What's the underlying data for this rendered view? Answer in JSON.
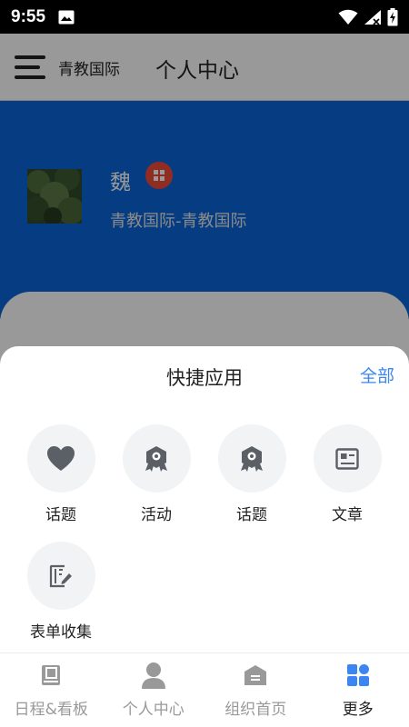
{
  "status_bar": {
    "time": "9:55"
  },
  "header": {
    "org_name": "青教国际",
    "title": "个人中心"
  },
  "profile": {
    "name": "魏",
    "org": "青教国际-青教国际"
  },
  "sheet": {
    "title": "快捷应用",
    "all_label": "全部",
    "apps": [
      {
        "label": "话题",
        "icon": "heart-icon"
      },
      {
        "label": "活动",
        "icon": "award-ribbon-icon"
      },
      {
        "label": "话题",
        "icon": "award-ribbon-icon"
      },
      {
        "label": "文章",
        "icon": "article-icon"
      },
      {
        "label": "表单收集",
        "icon": "form-edit-icon"
      }
    ]
  },
  "bottom_nav": {
    "items": [
      {
        "label": "日程&看板",
        "icon": "book-icon"
      },
      {
        "label": "个人中心",
        "icon": "person-icon"
      },
      {
        "label": "组织首页",
        "icon": "home-icon"
      },
      {
        "label": "更多",
        "icon": "grid-icon",
        "active": true
      }
    ]
  },
  "colors": {
    "accent": "#3b86f3",
    "banner": "#0a66d9",
    "badge": "#f04a37",
    "icon_gray": "#5b5f66",
    "nav_inactive": "#999999"
  }
}
